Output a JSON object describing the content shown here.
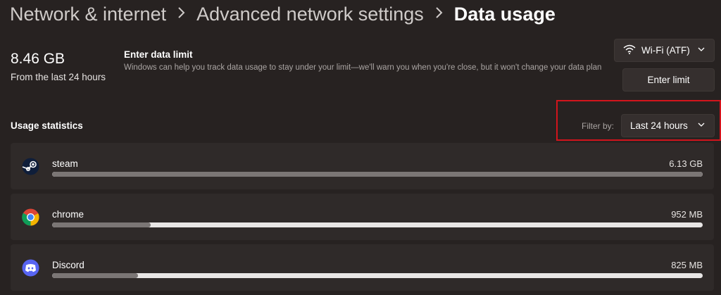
{
  "breadcrumb": {
    "items": [
      "Network & internet",
      "Advanced network settings"
    ],
    "current": "Data usage"
  },
  "total": {
    "value": "8.46 GB",
    "caption": "From the last 24 hours"
  },
  "data_limit": {
    "title": "Enter data limit",
    "description": "Windows can help you track data usage to stay under your limit—we'll warn you when you're close, but it won't change your data plan",
    "button_label": "Enter limit"
  },
  "network": {
    "selected": "Wi-Fi (ATF)",
    "icon": "wifi-icon"
  },
  "usage": {
    "title": "Usage statistics",
    "filter_label": "Filter by:",
    "filter_selected": "Last 24 hours",
    "apps": [
      {
        "name": "steam",
        "size": "6.13 GB",
        "fraction": 1.0,
        "icon": "steam-icon"
      },
      {
        "name": "chrome",
        "size": "952 MB",
        "fraction": 0.152,
        "icon": "chrome-icon"
      },
      {
        "name": "Discord",
        "size": "825 MB",
        "fraction": 0.132,
        "icon": "discord-icon"
      }
    ]
  },
  "colors": {
    "background": "#272221",
    "card": "#2f2a29",
    "highlight": "#d2141c",
    "bar_track": "#e8e6e5",
    "bar_fill": "#7b7675"
  }
}
